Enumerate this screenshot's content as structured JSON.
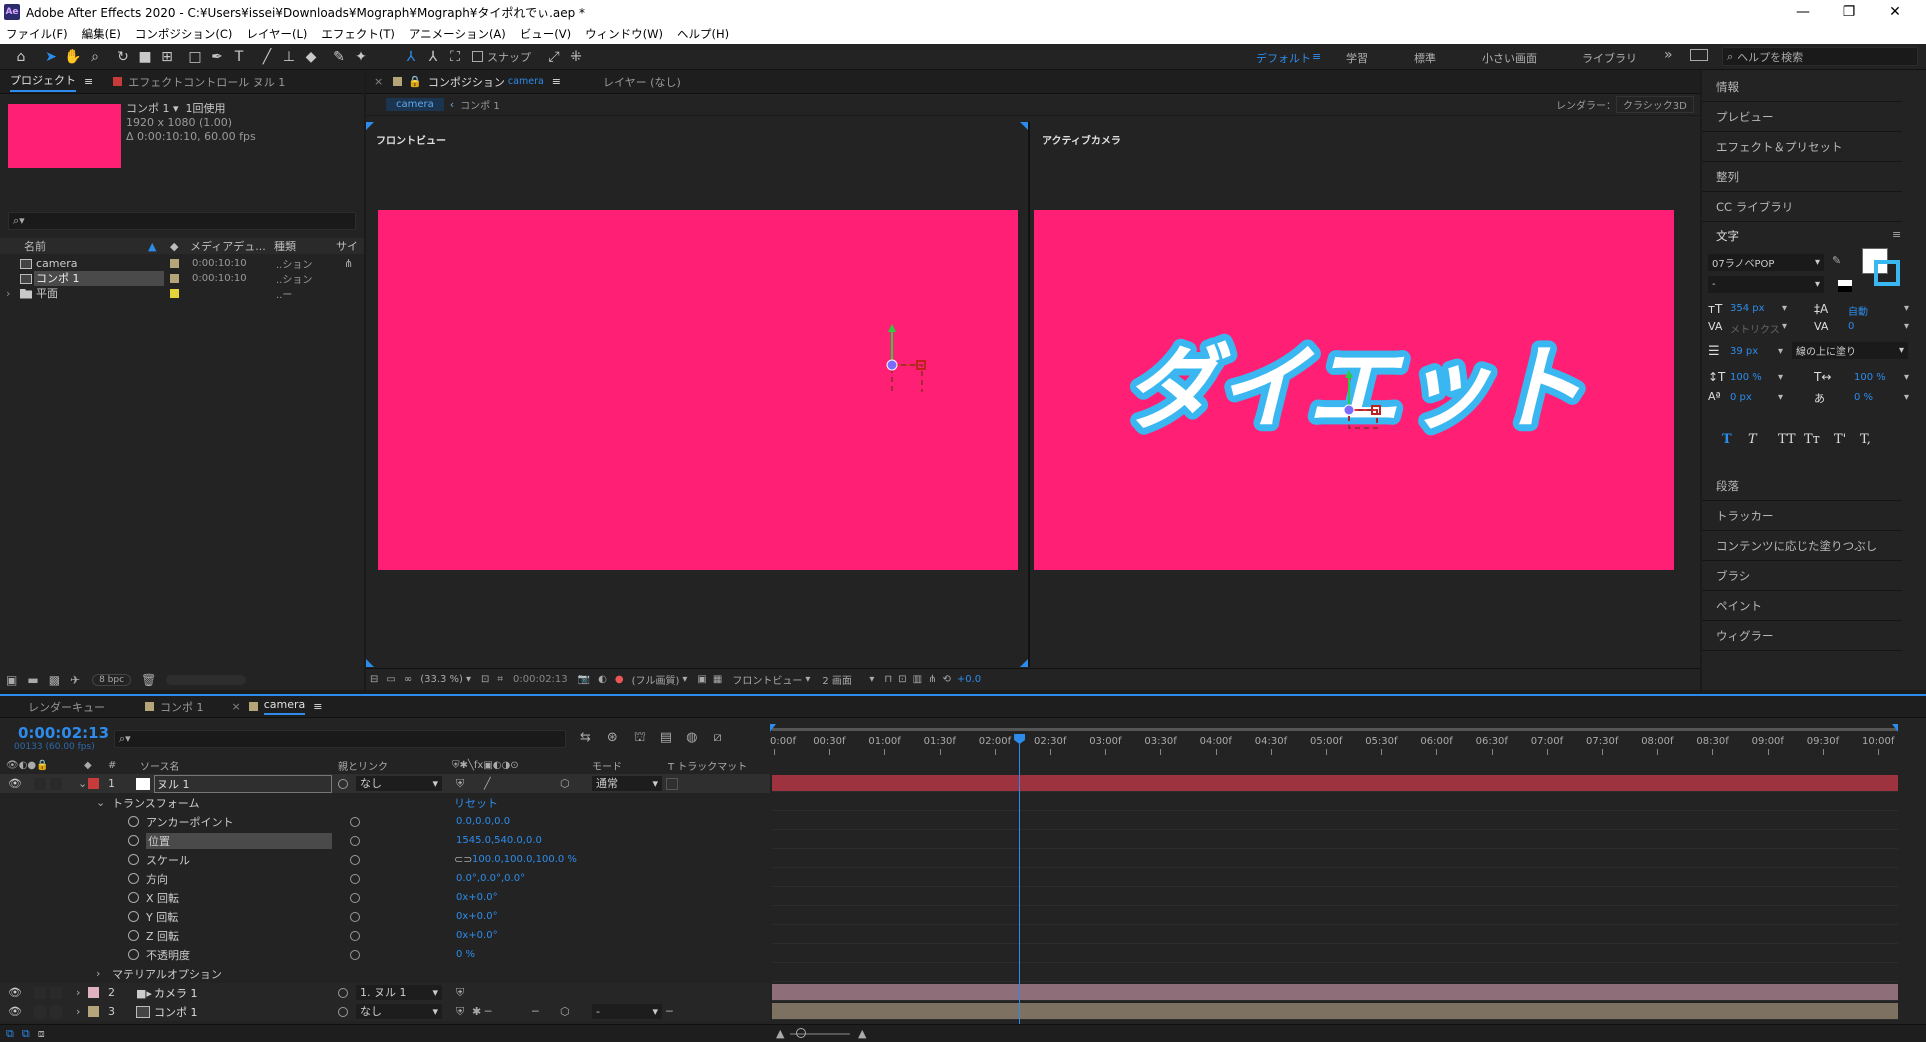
{
  "window": {
    "title": "Adobe After Effects 2020 - C:¥Users¥issei¥Downloads¥Mograph¥Mograph¥タイポれでぃ.aep *",
    "logo": "Ae"
  },
  "menu": [
    "ファイル(F)",
    "編集(E)",
    "コンポジション(C)",
    "レイヤー(L)",
    "エフェクト(T)",
    "アニメーション(A)",
    "ビュー(V)",
    "ウィンドウ(W)",
    "ヘルプ(H)"
  ],
  "toolbar": {
    "snap_label": "スナップ",
    "workspaces": [
      "デフォルト",
      "学習",
      "標準",
      "小さい画面",
      "ライブラリ"
    ],
    "active_workspace": "デフォルト",
    "more": "»",
    "help_search_placeholder": "ヘルプを検索"
  },
  "project_panel": {
    "tab_project": "プロジェクト",
    "tab_effect_controls": "エフェクトコントロール ヌル 1",
    "thumb_color": "#ff1f74",
    "selected_name": "コンポ 1 ▾",
    "selected_usage": "1回使用",
    "selected_dims": "1920 x 1080 (1.00)",
    "selected_duration": "Δ 0:00:10:10, 60.00 fps",
    "search_placeholder": "",
    "columns": [
      "名前",
      "メディアデュ...",
      "種類",
      "サイ"
    ],
    "items": [
      {
        "name": "camera",
        "duration": "0:00:10:10",
        "type": "..ション",
        "color": "#b5a67a",
        "selected": false
      },
      {
        "name": "コンポ 1",
        "duration": "0:00:10:10",
        "type": "..ション",
        "color": "#b5a67a",
        "selected": true
      },
      {
        "name": "平面",
        "duration": "",
        "type": "..ー",
        "color": "#e6d33a",
        "selected": false
      }
    ],
    "bpc": "8 bpc"
  },
  "comp_panel": {
    "tab_label": "コンポジション",
    "tab_comp_name": "camera",
    "layer_tab": "レイヤー (なし)",
    "breadcrumbs": [
      "camera",
      "コンポ 1"
    ],
    "renderer_label": "レンダラー：",
    "renderer_value": "クラシック3D",
    "left_view_label": "フロントビュー",
    "right_view_label": "アクティブカメラ",
    "bg_color": "#ff1f74",
    "title_text": "ダイエット",
    "title_fill": "#ffffff",
    "title_stroke": "#3ab7f0",
    "footer": {
      "zoom": "(33.3 %)",
      "timecode": "0:00:02:13",
      "quality": "(フル画質)",
      "view": "フロントビュー",
      "layout": "2 画面",
      "exposure": "+0.0"
    }
  },
  "right_panel": {
    "items_top": [
      "情報",
      "プレビュー",
      "エフェクト＆プリセット",
      "整列",
      "CC ライブラリ"
    ],
    "character_title": "文字",
    "font": "07ラノベPOP",
    "font_style": "-",
    "font_size": "354 px",
    "leading": "自動",
    "kerning": "メトリクス",
    "tracking": "0",
    "stroke_width": "39 px",
    "stroke_type": "線の上に塗り",
    "vscale": "100 %",
    "hscale": "100 %",
    "baseline": "0 px",
    "tsume": "0 %",
    "style_buttons": [
      "T",
      "T",
      "TT",
      "Tт",
      "T'",
      "T,"
    ],
    "items_bottom": [
      "段落",
      "トラッカー",
      "コンテンツに応じた塗りつぶし",
      "ブラシ",
      "ペイント",
      "ウィグラー"
    ]
  },
  "timeline": {
    "tabs": [
      "レンダーキュー",
      "コンポ 1",
      "camera"
    ],
    "current_time": "0:00:02:13",
    "frame_info": "00133 (60.00 fps)",
    "columns": {
      "num": "#",
      "source": "ソース名",
      "parent": "親とリンク",
      "mode": "モード",
      "trackmatte": "T  トラックマット"
    },
    "reset_label": "リセット",
    "layers": [
      {
        "num": "1",
        "name": "ヌル 1",
        "color": "#c83b3b",
        "parent": "なし",
        "mode": "通常",
        "bar_color": "#9e3340"
      },
      {
        "num": "2",
        "name": "カメラ 1",
        "color": "#e0b2c0",
        "parent": "1. ヌル 1",
        "bar_color": "#8e6f79"
      },
      {
        "num": "3",
        "name": "コンポ 1",
        "color": "#b5a67a",
        "parent": "なし",
        "mode": "-",
        "bar_color": "#7d7262"
      }
    ],
    "transform_label": "トランスフォーム",
    "properties": [
      {
        "name": "アンカーポイント",
        "value": "0.0,0.0,0.0"
      },
      {
        "name": "位置",
        "value": "1545.0,540.0,0.0"
      },
      {
        "name": "スケール",
        "value": "100.0,100.0,100.0 %"
      },
      {
        "name": "方向",
        "value": "0.0°,0.0°,0.0°"
      },
      {
        "name": "X 回転",
        "value": "0x+0.0°"
      },
      {
        "name": "Y 回転",
        "value": "0x+0.0°"
      },
      {
        "name": "Z 回転",
        "value": "0x+0.0°"
      },
      {
        "name": "不透明度",
        "value": "0 %"
      }
    ],
    "material_label": "マテリアルオプション",
    "ruler_ticks": [
      "0:00f",
      "00:30f",
      "01:00f",
      "01:30f",
      "02:00f",
      "02:30f",
      "03:00f",
      "03:30f",
      "04:00f",
      "04:30f",
      "05:00f",
      "05:30f",
      "06:00f",
      "06:30f",
      "07:00f",
      "07:30f",
      "08:00f",
      "08:30f",
      "09:00f",
      "09:30f",
      "10:00f"
    ],
    "playhead_seconds": 2.22,
    "duration_seconds": 10.17
  }
}
